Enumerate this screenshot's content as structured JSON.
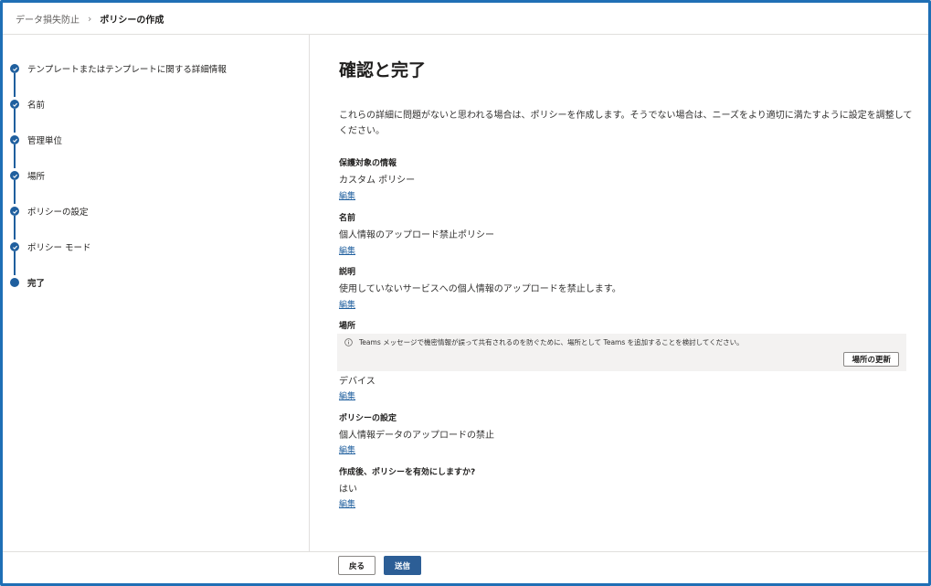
{
  "breadcrumb": {
    "parent": "データ損失防止",
    "current": "ポリシーの作成"
  },
  "steps": [
    {
      "label": "テンプレートまたはテンプレートに関する詳細情報",
      "state": "done"
    },
    {
      "label": "名前",
      "state": "done"
    },
    {
      "label": "管理単位",
      "state": "done"
    },
    {
      "label": "場所",
      "state": "done"
    },
    {
      "label": "ポリシーの設定",
      "state": "done"
    },
    {
      "label": "ポリシー モード",
      "state": "done"
    },
    {
      "label": "完了",
      "state": "current"
    }
  ],
  "main": {
    "title": "確認と完了",
    "intro": "これらの詳細に問題がないと思われる場合は、ポリシーを作成します。そうでない場合は、ニーズをより適切に満たすように設定を調整してください。",
    "sections": [
      {
        "heading": "保護対象の情報",
        "value": "カスタム ポリシー",
        "edit": "編集"
      },
      {
        "heading": "名前",
        "value": "個人情報のアップロード禁止ポリシー",
        "edit": "編集"
      },
      {
        "heading": "説明",
        "value": "使用していないサービスへの個人情報のアップロードを禁止します。",
        "edit": "編集"
      },
      {
        "heading": "場所",
        "value": "デバイス",
        "edit": "編集"
      },
      {
        "heading": "ポリシーの設定",
        "value": "個人情報データのアップロードの禁止",
        "edit": "編集"
      },
      {
        "heading": "作成後、ポリシーを有効にしますか?",
        "value": "はい",
        "edit": "編集"
      }
    ],
    "location_notice": {
      "text": "Teams メッセージで機密情報が誤って共有されるのを防ぐために、場所として Teams を追加することを検討してください。",
      "button": "場所の更新"
    }
  },
  "footer": {
    "back": "戻る",
    "submit": "送信"
  },
  "colors": {
    "accent": "#1f5f9e",
    "primary_button": "#2c5e96",
    "frame_border": "#1f6fb5"
  }
}
